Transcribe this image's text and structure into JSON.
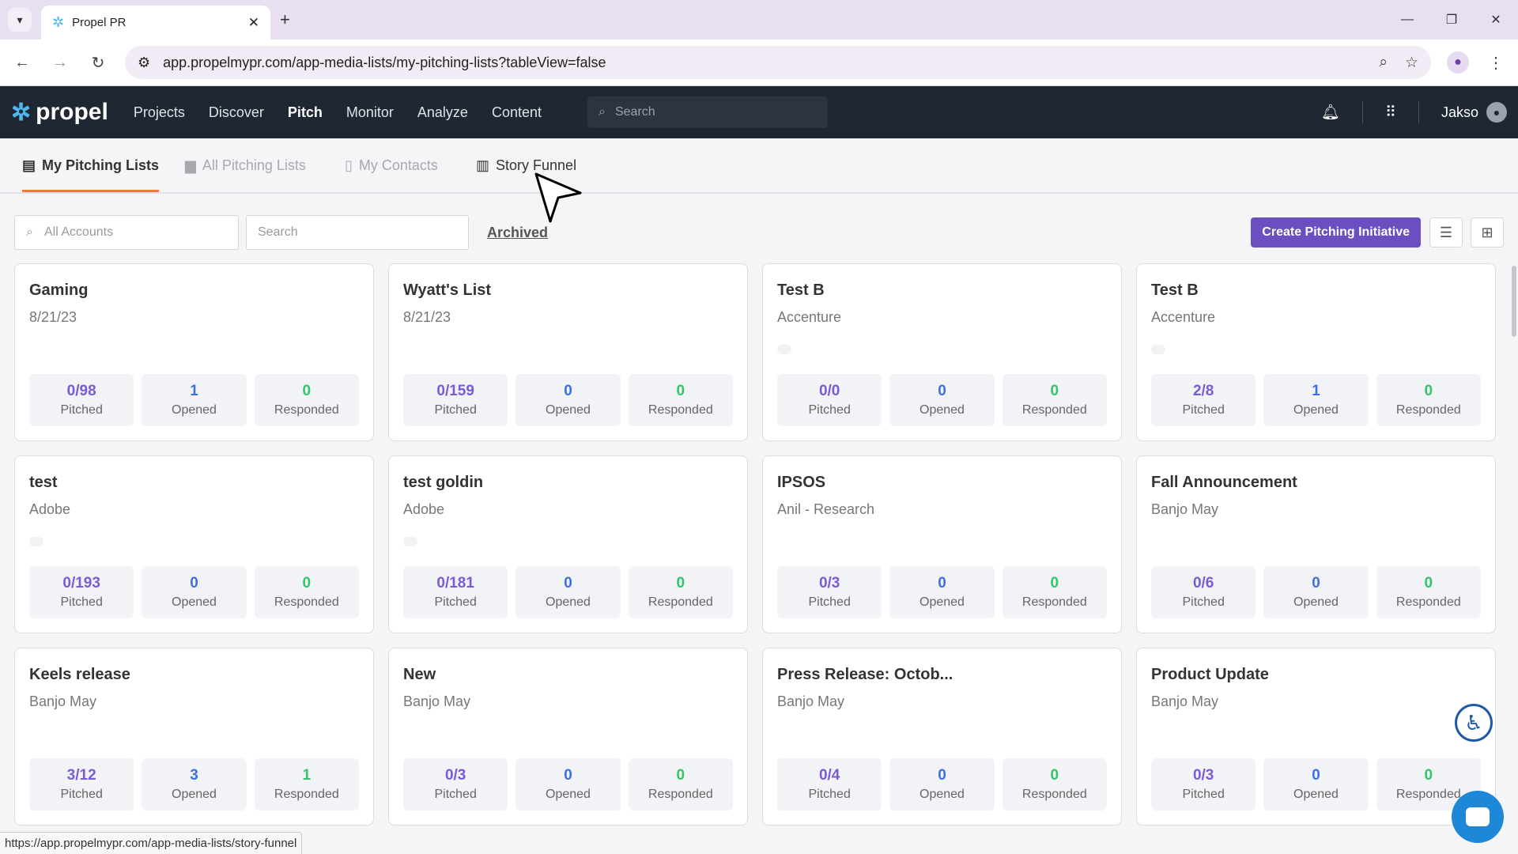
{
  "browser": {
    "tab_title": "Propel PR",
    "url": "app.propelmypr.com/app-media-lists/my-pitching-lists?tableView=false",
    "status_url": "https://app.propelmypr.com/app-media-lists/story-funnel"
  },
  "app": {
    "logo_text": "propel",
    "nav": [
      "Projects",
      "Discover",
      "Pitch",
      "Monitor",
      "Analyze",
      "Content"
    ],
    "active_nav": "Pitch",
    "search_placeholder": "Search",
    "user_name": "Jakso"
  },
  "subtabs": [
    "My Pitching Lists",
    "All Pitching Lists",
    "My Contacts",
    "Story Funnel"
  ],
  "filters": {
    "accounts_placeholder": "All Accounts",
    "search_placeholder": "Search",
    "archived_label": "Archived",
    "create_button": "Create Pitching Initiative"
  },
  "stat_labels": {
    "pitched": "Pitched",
    "opened": "Opened",
    "responded": "Responded"
  },
  "cards": [
    {
      "title": "Gaming",
      "subtitle": "8/21/23",
      "pitched": "0/98",
      "opened": "1",
      "responded": "0",
      "dot": false
    },
    {
      "title": "Wyatt's List",
      "subtitle": "8/21/23",
      "pitched": "0/159",
      "opened": "0",
      "responded": "0",
      "dot": false
    },
    {
      "title": "Test B",
      "subtitle": "Accenture",
      "pitched": "0/0",
      "opened": "0",
      "responded": "0",
      "dot": true
    },
    {
      "title": "Test B",
      "subtitle": "Accenture",
      "pitched": "2/8",
      "opened": "1",
      "responded": "0",
      "dot": true
    },
    {
      "title": "test",
      "subtitle": "Adobe",
      "pitched": "0/193",
      "opened": "0",
      "responded": "0",
      "dot": true
    },
    {
      "title": "test goldin",
      "subtitle": "Adobe",
      "pitched": "0/181",
      "opened": "0",
      "responded": "0",
      "dot": true
    },
    {
      "title": "IPSOS",
      "subtitle": "Anil - Research",
      "pitched": "0/3",
      "opened": "0",
      "responded": "0",
      "dot": false
    },
    {
      "title": "Fall Announcement",
      "subtitle": "Banjo May",
      "pitched": "0/6",
      "opened": "0",
      "responded": "0",
      "dot": false
    },
    {
      "title": "Keels release",
      "subtitle": "Banjo May",
      "pitched": "3/12",
      "opened": "3",
      "responded": "1",
      "dot": false
    },
    {
      "title": "New",
      "subtitle": "Banjo May",
      "pitched": "0/3",
      "opened": "0",
      "responded": "0",
      "dot": false
    },
    {
      "title": "Press Release: Octob...",
      "subtitle": "Banjo May",
      "pitched": "0/4",
      "opened": "0",
      "responded": "0",
      "dot": false
    },
    {
      "title": "Product Update",
      "subtitle": "Banjo May",
      "pitched": "0/3",
      "opened": "0",
      "responded": "0",
      "dot": false
    }
  ],
  "colors": {
    "accent": "#6b4fc0",
    "nav_bg": "#1f2733",
    "tab_underline": "#f07a3c",
    "pitched": "#7b5ad6",
    "opened": "#3d6fe0",
    "responded": "#34c46a"
  }
}
